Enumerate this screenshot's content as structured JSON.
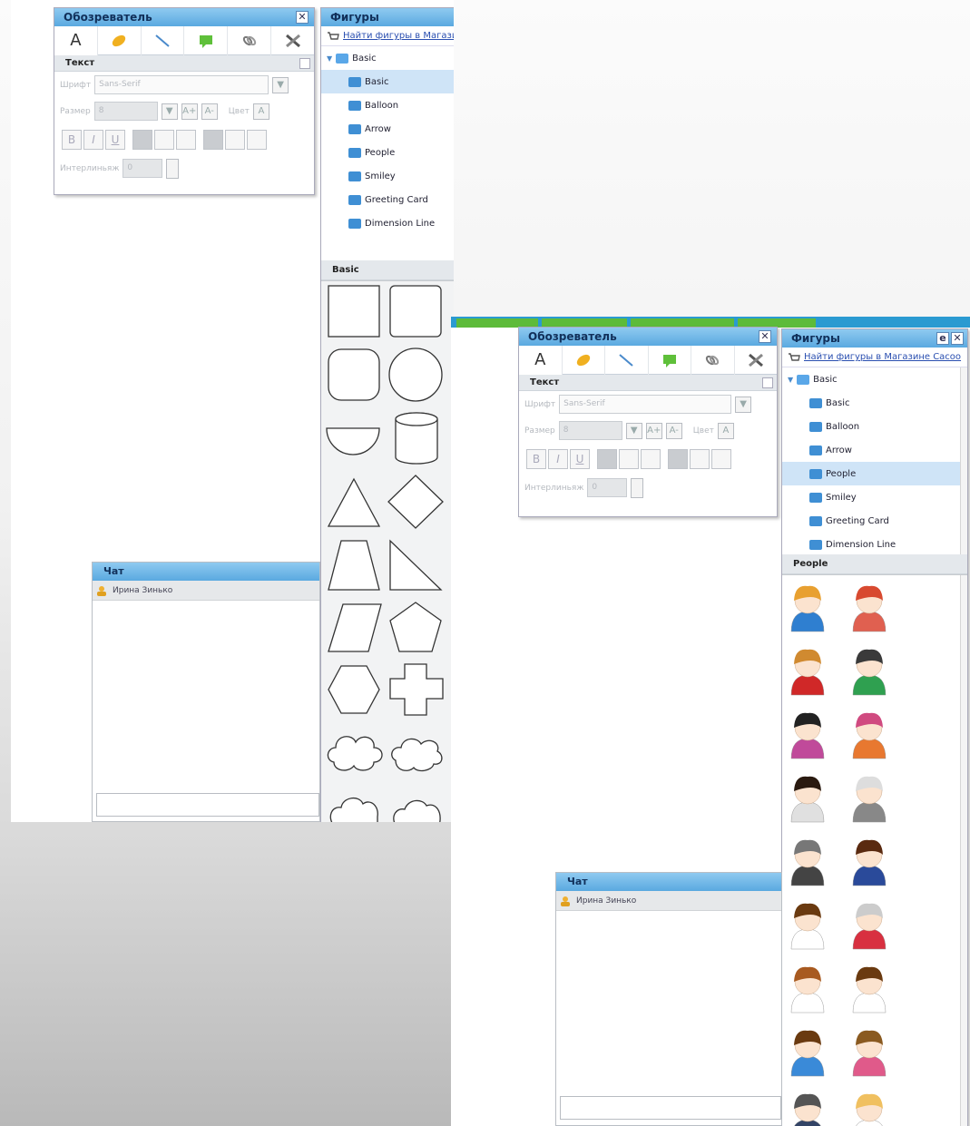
{
  "colors": {
    "title_blue": "#5aa9e0",
    "selection": "#cfe4f7",
    "link": "#2a4fb0",
    "top_green": "#5dbb3a"
  },
  "explorer": {
    "title": "Обозреватель",
    "close": "✕",
    "tab_text_glyph": "A",
    "tabs_icons": [
      "text-icon",
      "eraser-icon",
      "line-icon",
      "comment-icon",
      "link-icon",
      "tools-icon"
    ],
    "section": "Текст",
    "font_label": "Шрифт",
    "font_value": "Sans-Serif",
    "size_label": "Размер",
    "size_value": "8",
    "color_label": "Цвет",
    "interval_label": "Интерлиньяж",
    "interval_value": "0",
    "dropdown_arrow": "▼",
    "bold": "B",
    "italic": "I",
    "underline": "U",
    "grow": "A+",
    "shrink": "A-",
    "color_glyph": "A"
  },
  "shapes": {
    "title": "Фигуры",
    "link_text": "Найти фигуры в Магазине Cacoo",
    "tree_root": "Basic",
    "tree_items": [
      "Basic",
      "Balloon",
      "Arrow",
      "People",
      "Smiley",
      "Greeting Card",
      "Dimension Line"
    ],
    "selected_1": "Basic",
    "selected_2": "People",
    "area_title_1": "Basic",
    "area_title_2": "People",
    "icon_glyph": "Sh",
    "min_glyph": "e"
  },
  "chat": {
    "title": "Чат",
    "user": "Ирина Зинько"
  }
}
